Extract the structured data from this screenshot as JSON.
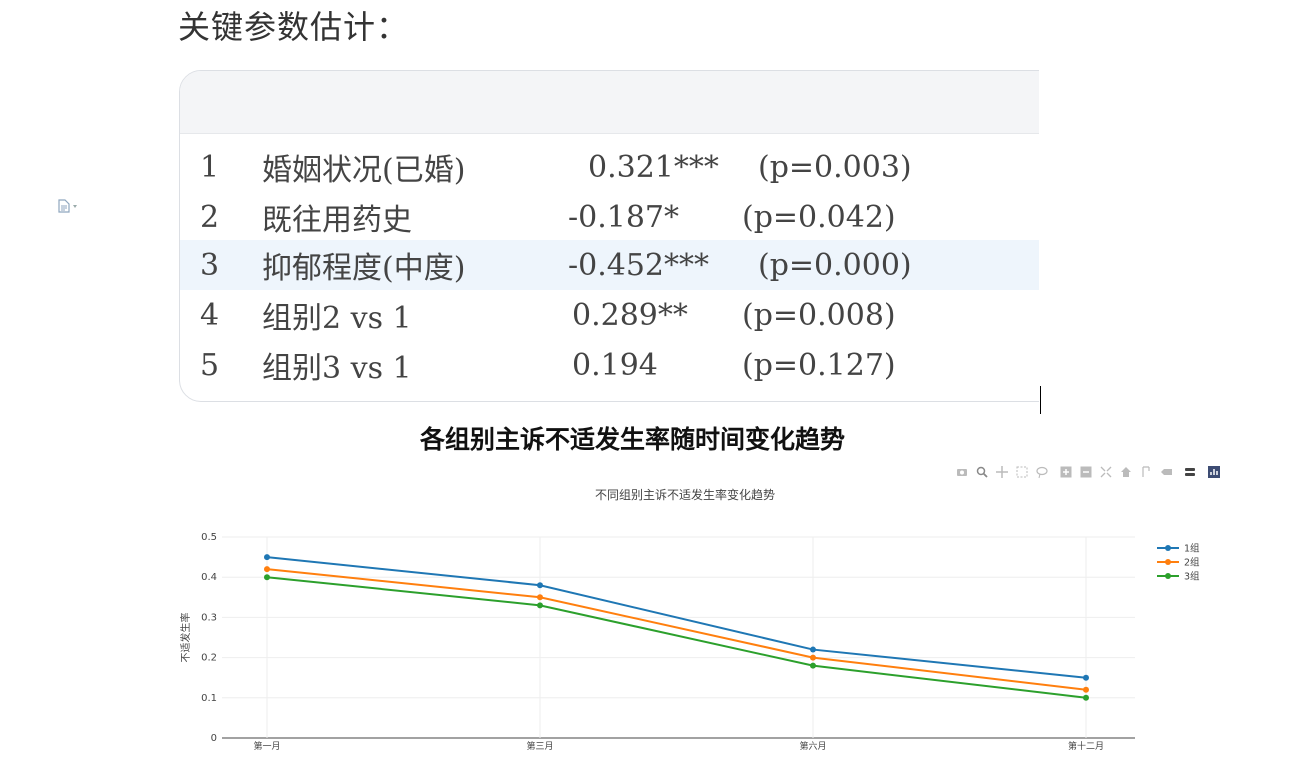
{
  "page": {
    "heading": "关键参数估计："
  },
  "table": {
    "rows": [
      {
        "idx": "1",
        "name": "婚姻状况(已婚)",
        "value": "0.321***",
        "p": "(p=0.003)",
        "highlight": false
      },
      {
        "idx": "2",
        "name": "既往用药史",
        "value": "-0.187*",
        "p": "(p=0.042)",
        "highlight": false
      },
      {
        "idx": "3",
        "name": "抑郁程度(中度)",
        "value": "-0.452***",
        "p": "(p=0.000)",
        "highlight": true
      },
      {
        "idx": "4",
        "name": "组别2 vs 1",
        "value": "0.289**",
        "p": "(p=0.008)",
        "highlight": false
      },
      {
        "idx": "5",
        "name": "组别3 vs 1",
        "value": "0.194",
        "p": "(p=0.127)",
        "highlight": false
      }
    ]
  },
  "toolbar": {
    "icons": [
      "camera-icon",
      "zoom-icon",
      "pan-icon",
      "box-select-icon",
      "lasso-icon",
      "zoom-in-icon",
      "zoom-out-icon",
      "autoscale-icon",
      "reset-axes-icon",
      "spike-lines-icon",
      "hover-closest-icon",
      "hover-compare-icon",
      "plotly-logo-icon"
    ]
  },
  "chart_data": {
    "type": "line",
    "title": "各组别主诉不适发生率随时间变化趋势",
    "subtitle": "不同组别主诉不适发生率变化趋势",
    "xlabel": "",
    "ylabel": "不适发生率",
    "categories": [
      "第一月",
      "第三月",
      "第六月",
      "第十二月"
    ],
    "ylim": [
      0,
      0.5
    ],
    "yticks": [
      "0",
      "0.1",
      "0.2",
      "0.3",
      "0.4",
      "0.5"
    ],
    "grid": true,
    "legend_position": "top-right",
    "series": [
      {
        "name": "1组",
        "values": [
          0.45,
          0.38,
          0.22,
          0.15
        ],
        "color": "#1f77b4"
      },
      {
        "name": "2组",
        "values": [
          0.42,
          0.35,
          0.2,
          0.12
        ],
        "color": "#ff7f0e"
      },
      {
        "name": "3组",
        "values": [
          0.4,
          0.33,
          0.18,
          0.1
        ],
        "color": "#2ca02c"
      }
    ]
  }
}
